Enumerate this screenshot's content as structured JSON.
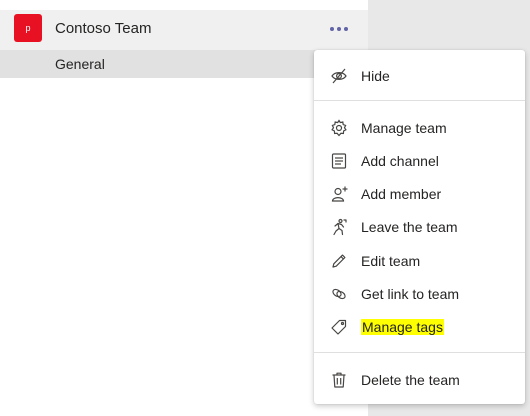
{
  "team": {
    "avatar_letter": "p",
    "avatar_color": "#e81123",
    "name": "Contoso Team",
    "channel": "General"
  },
  "menu": {
    "items": [
      {
        "label": "Hide",
        "icon": "hide-eye-slash-icon"
      },
      {
        "label": "Manage team",
        "icon": "gear-icon"
      },
      {
        "label": "Add channel",
        "icon": "channel-list-icon"
      },
      {
        "label": "Add member",
        "icon": "person-add-icon"
      },
      {
        "label": "Leave the team",
        "icon": "leave-runner-icon"
      },
      {
        "label": "Edit team",
        "icon": "pencil-icon"
      },
      {
        "label": "Get link to team",
        "icon": "link-icon"
      },
      {
        "label": "Manage tags",
        "icon": "tag-icon",
        "highlighted": true
      },
      {
        "label": "Delete the team",
        "icon": "trash-icon"
      }
    ]
  },
  "colors": {
    "accent": "#6264a7",
    "highlight": "#ffff00"
  }
}
